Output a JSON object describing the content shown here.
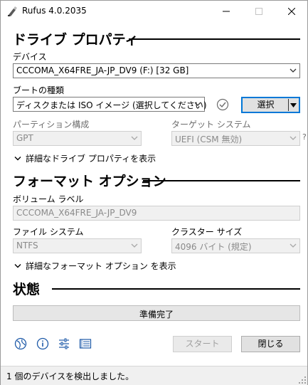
{
  "window": {
    "title": "Rufus 4.0.2035",
    "min_icon": "minimize-icon",
    "max_icon": "maximize-icon",
    "close_icon": "close-icon"
  },
  "drive_properties": {
    "header": "ドライブ プロパティ",
    "device_label": "デバイス",
    "device_value": "CCCOMA_X64FRE_JA-JP_DV9 (F:) [32 GB]",
    "boot_label": "ブートの種類",
    "boot_value": "ディスクまたは ISO イメージ (選択してください)",
    "select_button": "選択",
    "partition_label": "パーティション構成",
    "partition_value": "GPT",
    "target_label": "ターゲット システム",
    "target_value": "UEFI (CSM 無効)",
    "help_mark": "?",
    "advanced_toggle": "詳細なドライブ プロパティを表示"
  },
  "format_options": {
    "header": "フォーマット オプション",
    "volume_label": "ボリューム ラベル",
    "volume_value": "CCCOMA_X64FRE_JA-JP_DV9",
    "fs_label": "ファイル システム",
    "fs_value": "NTFS",
    "cluster_label": "クラスター サイズ",
    "cluster_value": "4096 バイト (規定)",
    "advanced_toggle": "詳細なフォーマット オプション を表示"
  },
  "status": {
    "header": "状態",
    "progress_text": "準備完了",
    "progress_value": 0
  },
  "actions": {
    "start": "スタート",
    "close": "閉じる",
    "icons": [
      "globe-icon",
      "info-icon",
      "settings-sliders-icon",
      "log-icon"
    ]
  },
  "statusbar": {
    "text": "1 個のデバイスを検出しました。"
  },
  "colors": {
    "accent": "#0078d7",
    "check_circle": "#6d6d6d",
    "icon_blue": "#1e5aa8"
  }
}
